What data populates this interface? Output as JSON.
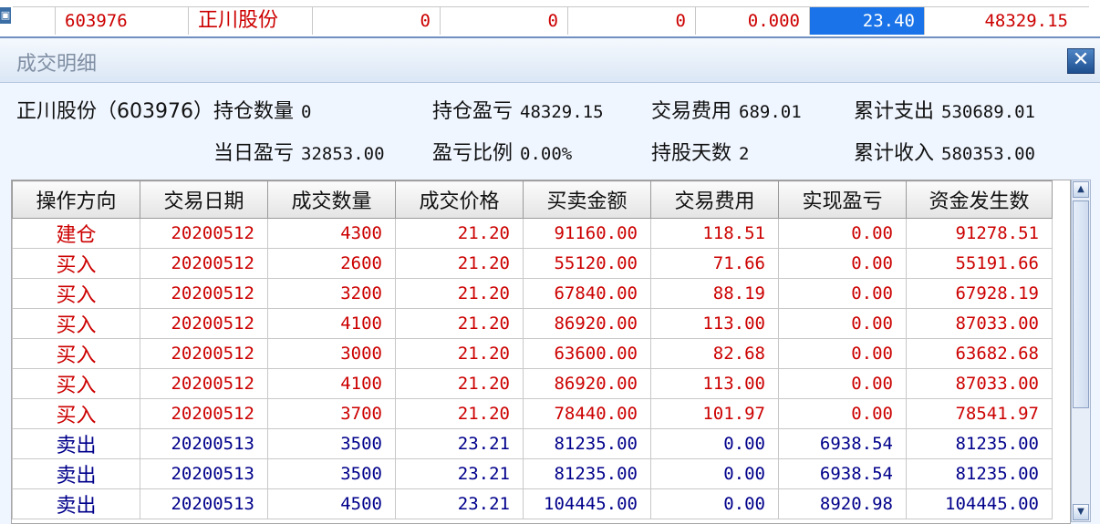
{
  "top_row": {
    "code": "603976",
    "name": "正川股份",
    "col_a": "0",
    "col_b": "0",
    "col_c": "0",
    "col_d": "0.000",
    "price": "23.40",
    "pnl": "48329.15"
  },
  "dialog": {
    "title": "成交明细",
    "close_icon": "close-icon"
  },
  "summary": {
    "stock": "正川股份（603976）",
    "position_qty_label": "持仓数量",
    "position_qty_value": "0",
    "position_pnl_label": "持仓盈亏",
    "position_pnl_value": "48329.15",
    "fee_label": "交易费用",
    "fee_value": "689.01",
    "total_out_label": "累计支出",
    "total_out_value": "530689.01",
    "day_pnl_label": "当日盈亏",
    "day_pnl_value": "32853.00",
    "pnl_ratio_label": "盈亏比例",
    "pnl_ratio_value": "0.00%",
    "hold_days_label": "持股天数",
    "hold_days_value": "2",
    "total_in_label": "累计收入",
    "total_in_value": "580353.00"
  },
  "table": {
    "headers": [
      "操作方向",
      "交易日期",
      "成交数量",
      "成交价格",
      "买卖金额",
      "交易费用",
      "实现盈亏",
      "资金发生数"
    ],
    "rows": [
      [
        "建仓",
        "20200512",
        "4300",
        "21.20",
        "91160.00",
        "118.51",
        "0.00",
        "91278.51"
      ],
      [
        "买入",
        "20200512",
        "2600",
        "21.20",
        "55120.00",
        "71.66",
        "0.00",
        "55191.66"
      ],
      [
        "买入",
        "20200512",
        "3200",
        "21.20",
        "67840.00",
        "88.19",
        "0.00",
        "67928.19"
      ],
      [
        "买入",
        "20200512",
        "4100",
        "21.20",
        "86920.00",
        "113.00",
        "0.00",
        "87033.00"
      ],
      [
        "买入",
        "20200512",
        "3000",
        "21.20",
        "63600.00",
        "82.68",
        "0.00",
        "63682.68"
      ],
      [
        "买入",
        "20200512",
        "4100",
        "21.20",
        "86920.00",
        "113.00",
        "0.00",
        "87033.00"
      ],
      [
        "买入",
        "20200512",
        "3700",
        "21.20",
        "78440.00",
        "101.97",
        "0.00",
        "78541.97"
      ],
      [
        "卖出",
        "20200513",
        "3500",
        "23.21",
        "81235.00",
        "0.00",
        "6938.54",
        "81235.00"
      ],
      [
        "卖出",
        "20200513",
        "3500",
        "23.21",
        "81235.00",
        "0.00",
        "6938.54",
        "81235.00"
      ],
      [
        "卖出",
        "20200513",
        "4500",
        "23.21",
        "104445.00",
        "0.00",
        "8920.98",
        "104445.00"
      ]
    ],
    "row_colors": [
      "red",
      "red",
      "red",
      "red",
      "red",
      "red",
      "red",
      "blue",
      "blue",
      "blue"
    ]
  },
  "colors": {
    "buy": "#cc0000",
    "sell": "#00008b",
    "highlight": "#1a73e8"
  }
}
